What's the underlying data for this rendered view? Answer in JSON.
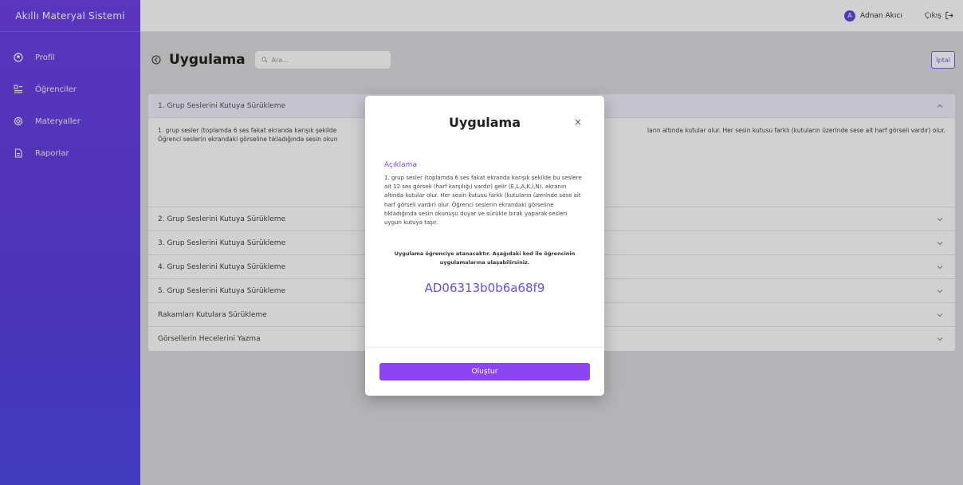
{
  "app": {
    "title": "Akıllı Materyal Sistemi"
  },
  "sidebar": {
    "items": [
      {
        "label": "Profil",
        "icon": "profile-icon"
      },
      {
        "label": "Öğrenciler",
        "icon": "students-icon"
      },
      {
        "label": "Materyaller",
        "icon": "materials-icon"
      },
      {
        "label": "Raporlar",
        "icon": "reports-icon"
      }
    ]
  },
  "topbar": {
    "user_initial": "A",
    "user_name": "Adnan Akıcı",
    "logout_label": "Çıkış"
  },
  "page": {
    "title": "Uygulama",
    "search_placeholder": "Ara...",
    "cancel_label": "İptal"
  },
  "accordion": {
    "items": [
      {
        "label": "1. Grup Seslerini Kutuya Sürükleme",
        "open": true,
        "body_line1": "1. grup sesler (toplamda 6 ses fakat ekranda karışık şekilde",
        "body_line1_end": "ların altında kutular olur. Her sesin kutusu farklı (kutuların üzerinde sese ait harf görseli vardır) olur.",
        "body_line2": "Öğrenci seslerin ekrandaki görseline tıkladığında sesin okun"
      },
      {
        "label": "2. Grup Seslerini Kutuya Sürükleme"
      },
      {
        "label": "3. Grup Seslerini Kutuya Sürükleme"
      },
      {
        "label": "4. Grup Seslerini Kutuya Sürükleme"
      },
      {
        "label": "5. Grup Seslerini Kutuya Sürükleme"
      },
      {
        "label": "Rakamları Kutulara Sürükleme"
      },
      {
        "label": "Görsellerin Hecelerini Yazma"
      }
    ]
  },
  "modal": {
    "title": "Uygulama",
    "close": "×",
    "section_label": "Açıklama",
    "description": "1. grup sesler (toplamda 6 ses fakat ekranda karışık şekilde bu seslere ait 12 ses görseli (harf karşılığı) vardır) gelir (E,L,A,K,İ,N). ekranın altında kutular olur. Her sesin kutusu farklı (kutuların üzerinde sese ait harf görseli vardır) olur. Öğrenci seslerin ekrandaki görseline tıkladığında sesin okunuşu duyar ve sürükle bırak yaparak sesleri uygun kutuya taşır.",
    "note": "Uygulama öğrenciye atanacaktır. Aşağıdaki kod ile öğrencinin uygulamalarına ulaşabilirsiniz.",
    "code": "AD06313b0b6a68f9",
    "button_label": "Oluştur"
  },
  "colors": {
    "accent": "#7a4fe0",
    "sidebar": "#6f42e8",
    "button": "#8b46f0"
  }
}
